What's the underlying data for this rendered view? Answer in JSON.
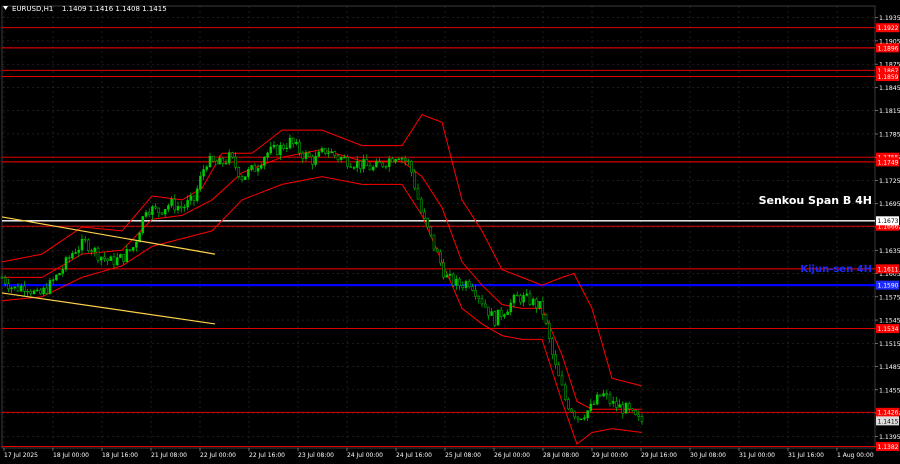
{
  "header": {
    "symbol": "EURUSD,H1",
    "ohlc": "1.1409 1.1416 1.1408 1.1415"
  },
  "annotations": {
    "senkou": "Senkou Span B 4H",
    "kijun": "Kijun-sen 4H"
  },
  "colors": {
    "background": "#000000",
    "grid": "#3a3a3a",
    "candles": "#00cc00",
    "ichimoku": "#ff0000",
    "level": "#ff0000",
    "senkou": "#ffffff",
    "kijun": "#0000ff",
    "trend": "#ffd24d",
    "axis_text": "#ffffff"
  },
  "chart_data": {
    "type": "candlestick",
    "ylim": [
      1.138,
      1.195
    ],
    "y_ticks": [
      "1.1935",
      "1.1905",
      "1.1875",
      "1.1845",
      "1.1815",
      "1.1785",
      "1.1755",
      "1.1725",
      "1.1695",
      "1.1665",
      "1.1635",
      "1.1605",
      "1.1575",
      "1.1545",
      "1.1515",
      "1.1485",
      "1.1455",
      "1.1425",
      "1.1395"
    ],
    "x_ticks": [
      "17 Jul 2025",
      "18 Jul 00:00",
      "18 Jul 16:00",
      "21 Jul 08:00",
      "22 Jul 00:00",
      "22 Jul 16:00",
      "23 Jul 08:00",
      "24 Jul 00:00",
      "24 Jul 16:00",
      "25 Jul 08:00",
      "26 Jul 00:00",
      "28 Jul 08:00",
      "29 Jul 00:00",
      "29 Jul 16:00",
      "30 Jul 08:00",
      "31 Jul 00:00",
      "31 Jul 16:00",
      "1 Aug 00:00"
    ],
    "levels": [
      {
        "label": "1.1922",
        "value": 1.1922
      },
      {
        "label": "1.1896",
        "value": 1.1896
      },
      {
        "label": "1.1867",
        "value": 1.1867
      },
      {
        "label": "1.1859",
        "value": 1.1859
      },
      {
        "label": "1.1755",
        "value": 1.1755
      },
      {
        "label": "1.1749",
        "value": 1.1749
      },
      {
        "label": "1.1666",
        "value": 1.1666
      },
      {
        "label": "1.1611",
        "value": 1.1611
      },
      {
        "label": "1.1534",
        "value": 1.1534
      },
      {
        "label": "1.1426",
        "value": 1.1426
      },
      {
        "label": "1.1382",
        "value": 1.1382
      }
    ],
    "senkou_span_b": {
      "label": "1.1673",
      "value": 1.1673
    },
    "kijun_sen": {
      "label": "1.1590",
      "value": 1.159
    },
    "current_price": {
      "label": "1.1415",
      "value": 1.1415
    },
    "close_path": [
      [
        0,
        1.16
      ],
      [
        12,
        1.1585
      ],
      [
        24,
        1.159
      ],
      [
        36,
        1.1575
      ],
      [
        48,
        1.159
      ],
      [
        60,
        1.161
      ],
      [
        72,
        1.1635
      ],
      [
        84,
        1.1645
      ],
      [
        96,
        1.163
      ],
      [
        108,
        1.162
      ],
      [
        120,
        1.1625
      ],
      [
        132,
        1.164
      ],
      [
        144,
        1.169
      ],
      [
        156,
        1.1685
      ],
      [
        168,
        1.1695
      ],
      [
        180,
        1.169
      ],
      [
        192,
        1.17
      ],
      [
        204,
        1.175
      ],
      [
        216,
        1.1745
      ],
      [
        228,
        1.1755
      ],
      [
        240,
        1.173
      ],
      [
        252,
        1.174
      ],
      [
        264,
        1.176
      ],
      [
        276,
        1.1765
      ],
      [
        288,
        1.1775
      ],
      [
        300,
        1.176
      ],
      [
        312,
        1.175
      ],
      [
        324,
        1.1765
      ],
      [
        336,
        1.1755
      ],
      [
        348,
        1.175
      ],
      [
        360,
        1.1745
      ],
      [
        372,
        1.174
      ],
      [
        384,
        1.175
      ],
      [
        396,
        1.176
      ],
      [
        408,
        1.1745
      ],
      [
        420,
        1.168
      ],
      [
        432,
        1.164
      ],
      [
        444,
        1.16
      ],
      [
        456,
        1.159
      ],
      [
        468,
        1.1595
      ],
      [
        480,
        1.157
      ],
      [
        492,
        1.1545
      ],
      [
        504,
        1.156
      ],
      [
        516,
        1.1575
      ],
      [
        528,
        1.157
      ],
      [
        540,
        1.156
      ],
      [
        552,
        1.149
      ],
      [
        564,
        1.144
      ],
      [
        576,
        1.142
      ],
      [
        588,
        1.143
      ],
      [
        600,
        1.145
      ],
      [
        612,
        1.1435
      ],
      [
        624,
        1.143
      ],
      [
        636,
        1.1415
      ],
      [
        642,
        1.1415
      ]
    ],
    "cloud_upper": [
      [
        0,
        1.162
      ],
      [
        40,
        1.163
      ],
      [
        80,
        1.1665
      ],
      [
        120,
        1.166
      ],
      [
        150,
        1.1705
      ],
      [
        180,
        1.17
      ],
      [
        200,
        1.1715
      ],
      [
        220,
        1.176
      ],
      [
        250,
        1.176
      ],
      [
        280,
        1.179
      ],
      [
        320,
        1.179
      ],
      [
        360,
        1.177
      ],
      [
        400,
        1.177
      ],
      [
        420,
        1.181
      ],
      [
        440,
        1.18
      ],
      [
        460,
        1.17
      ],
      [
        480,
        1.166
      ],
      [
        500,
        1.161
      ],
      [
        520,
        1.16
      ],
      [
        540,
        1.159
      ],
      [
        560,
        1.16
      ],
      [
        572,
        1.1605
      ],
      [
        590,
        1.156
      ],
      [
        610,
        1.147
      ],
      [
        640,
        1.146
      ]
    ],
    "cloud_lower": [
      [
        0,
        1.157
      ],
      [
        40,
        1.1575
      ],
      [
        80,
        1.16
      ],
      [
        120,
        1.1615
      ],
      [
        150,
        1.164
      ],
      [
        180,
        1.165
      ],
      [
        210,
        1.166
      ],
      [
        240,
        1.17
      ],
      [
        280,
        1.172
      ],
      [
        320,
        1.173
      ],
      [
        360,
        1.172
      ],
      [
        400,
        1.172
      ],
      [
        420,
        1.168
      ],
      [
        440,
        1.162
      ],
      [
        460,
        1.156
      ],
      [
        480,
        1.154
      ],
      [
        500,
        1.1525
      ],
      [
        520,
        1.152
      ],
      [
        540,
        1.152
      ],
      [
        560,
        1.144
      ],
      [
        575,
        1.1385
      ],
      [
        590,
        1.14
      ],
      [
        610,
        1.1405
      ],
      [
        640,
        1.14
      ]
    ],
    "ma_line": [
      [
        0,
        1.16
      ],
      [
        40,
        1.16
      ],
      [
        80,
        1.163
      ],
      [
        120,
        1.1635
      ],
      [
        150,
        1.1675
      ],
      [
        180,
        1.168
      ],
      [
        210,
        1.17
      ],
      [
        240,
        1.1735
      ],
      [
        280,
        1.1755
      ],
      [
        320,
        1.1765
      ],
      [
        360,
        1.175
      ],
      [
        400,
        1.175
      ],
      [
        420,
        1.173
      ],
      [
        440,
        1.169
      ],
      [
        460,
        1.162
      ],
      [
        480,
        1.159
      ],
      [
        500,
        1.1565
      ],
      [
        520,
        1.156
      ],
      [
        540,
        1.156
      ],
      [
        560,
        1.15
      ],
      [
        575,
        1.144
      ],
      [
        590,
        1.143
      ],
      [
        610,
        1.143
      ],
      [
        640,
        1.143
      ]
    ],
    "trend_lines": [
      {
        "x1": 0,
        "y1": 1.1678,
        "x2": 213,
        "y2": 1.163
      },
      {
        "x1": 0,
        "y1": 1.158,
        "x2": 213,
        "y2": 1.154
      }
    ]
  }
}
